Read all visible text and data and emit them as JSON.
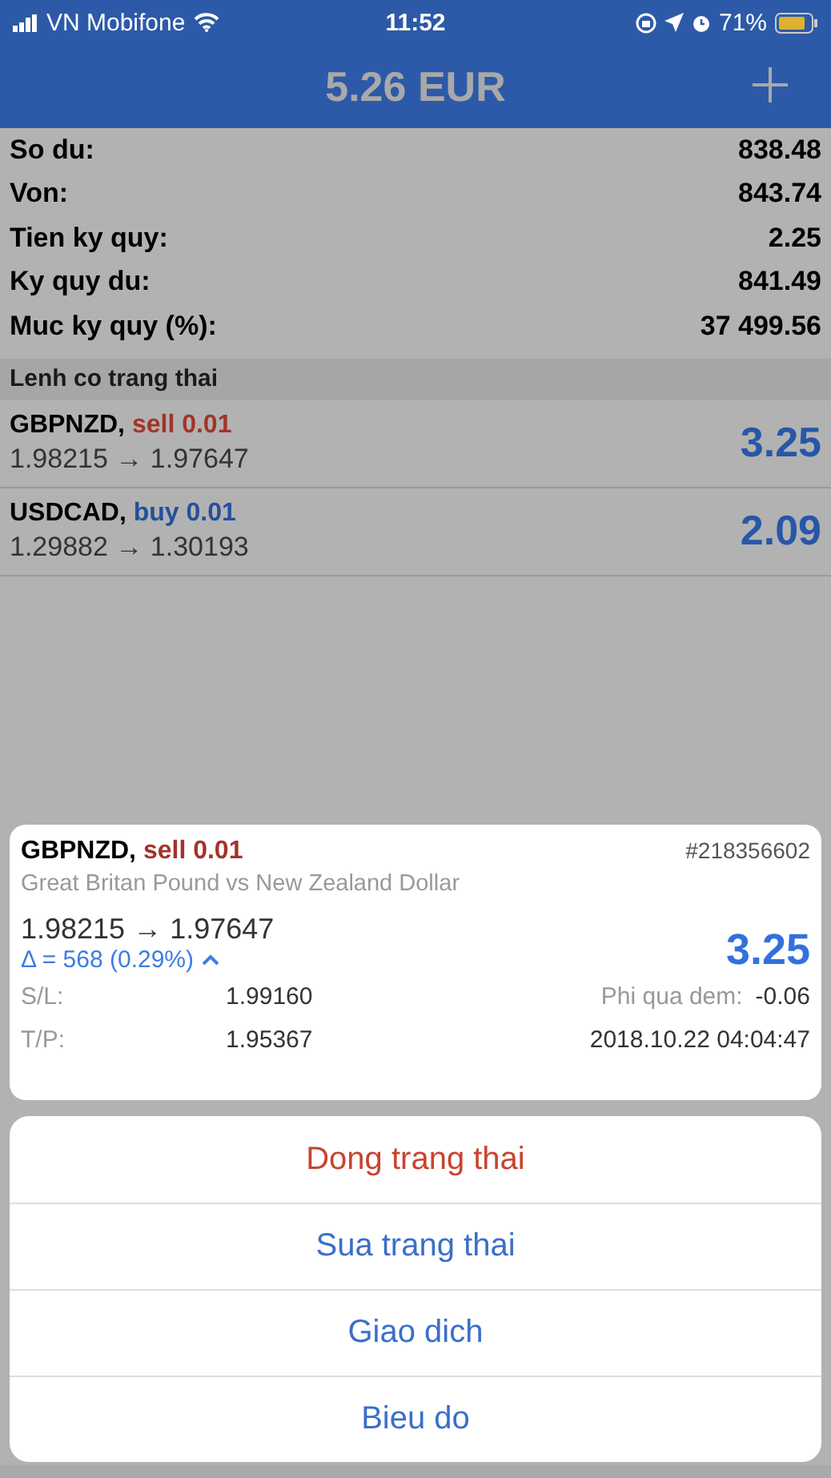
{
  "status_bar": {
    "carrier": "VN Mobifone",
    "time": "11:52",
    "battery": "71%"
  },
  "header": {
    "title": "5.26 EUR"
  },
  "account": [
    {
      "label": "So du:",
      "value": "838.48"
    },
    {
      "label": "Von:",
      "value": "843.74"
    },
    {
      "label": "Tien ky quy:",
      "value": "2.25"
    },
    {
      "label": "Ky quy du:",
      "value": "841.49"
    },
    {
      "label": "Muc ky quy (%):",
      "value": "37 499.56"
    }
  ],
  "section_title": "Lenh co trang thai",
  "positions": [
    {
      "symbol": "GBPNZD,",
      "kind": "sell",
      "order": "sell 0.01",
      "prices": "1.98215 → 1.97647",
      "profit": "3.25"
    },
    {
      "symbol": "USDCAD,",
      "kind": "buy",
      "order": "buy 0.01",
      "prices": "1.29882 → 1.30193",
      "profit": "2.09"
    }
  ],
  "detail": {
    "symbol": "GBPNZD,",
    "kind": "sell",
    "order": "sell 0.01",
    "ticket": "#218356602",
    "description": "Great Britan Pound vs New Zealand Dollar",
    "prices": "1.98215 → 1.97647",
    "delta": "Δ = 568 (0.29%)",
    "profit": "3.25",
    "sl_label": "S/L:",
    "sl_value": "1.99160",
    "swap_label": "Phi qua dem:",
    "swap_value": "-0.06",
    "tp_label": "T/P:",
    "tp_value": "1.95367",
    "time": "2018.10.22 04:04:47"
  },
  "actions": [
    {
      "label": "Dong trang thai",
      "kind": "destructive"
    },
    {
      "label": "Sua trang thai",
      "kind": "default"
    },
    {
      "label": "Giao dich",
      "kind": "default"
    },
    {
      "label": "Bieu do",
      "kind": "default"
    }
  ]
}
